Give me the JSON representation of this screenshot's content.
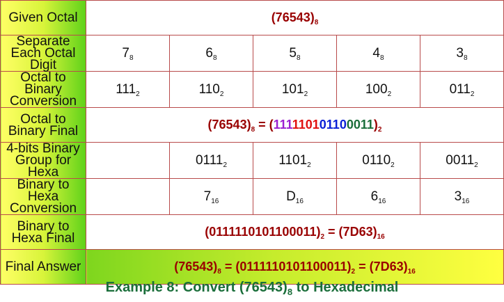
{
  "labels": {
    "given": "Given Octal",
    "separate": "Separate Each Octal Digit",
    "oct_bin": "Octal to Binary Conversion",
    "oct_bin_final": "Octal to Binary Final",
    "group": "4-bits Binary Group for Hexa",
    "bin_hex": "Binary to Hexa Conversion",
    "bin_hex_final": "Binary to Hexa Final",
    "final": "Final Answer"
  },
  "given": {
    "value": "(76543)",
    "base": "8"
  },
  "digits": [
    {
      "value": "7",
      "base": "8"
    },
    {
      "value": "6",
      "base": "8"
    },
    {
      "value": "5",
      "base": "8"
    },
    {
      "value": "4",
      "base": "8"
    },
    {
      "value": "3",
      "base": "8"
    }
  ],
  "binary": [
    {
      "value": "111",
      "base": "2"
    },
    {
      "value": "110",
      "base": "2"
    },
    {
      "value": "101",
      "base": "2"
    },
    {
      "value": "100",
      "base": "2"
    },
    {
      "value": "011",
      "base": "2"
    }
  ],
  "oct_bin_final": {
    "lhs": "(76543)",
    "lhs_base": "8",
    "eq": " = (",
    "g1": "111",
    "g2": "1101",
    "g3": "0110",
    "g4": "0011",
    "close": ")",
    "rhs_base": "2",
    "colors": {
      "g1": "#9b1fd1",
      "g2": "#e01010",
      "g3": "#0a1fd6",
      "g4": "#1a6e3a"
    }
  },
  "groups": [
    {
      "value": "0111",
      "base": "2",
      "color": "#9b1fd1"
    },
    {
      "value": "1101",
      "base": "2",
      "color": "#e01010"
    },
    {
      "value": "0110",
      "base": "2",
      "color": "#0a1fd6"
    },
    {
      "value": "0011",
      "base": "2",
      "color": "#1a6e3a"
    }
  ],
  "hexdigits": [
    {
      "value": "7",
      "base": "16"
    },
    {
      "value": "D",
      "base": "16"
    },
    {
      "value": "6",
      "base": "16"
    },
    {
      "value": "3",
      "base": "16"
    }
  ],
  "bin_hex_final": {
    "lhs": "(0111110101100011)",
    "lhs_base": "2",
    "rhs": " = (7D63)",
    "rhs_base": "16"
  },
  "final_answer": {
    "a": "(76543)",
    "a_base": "8",
    "b": " = (0111110101100011)",
    "b_base": "2",
    "c": " = (7D63)",
    "c_base": "16"
  },
  "caption": {
    "pre": "Example 8: Convert (76543)",
    "base": "8",
    "post": " to Hexadecimal"
  }
}
